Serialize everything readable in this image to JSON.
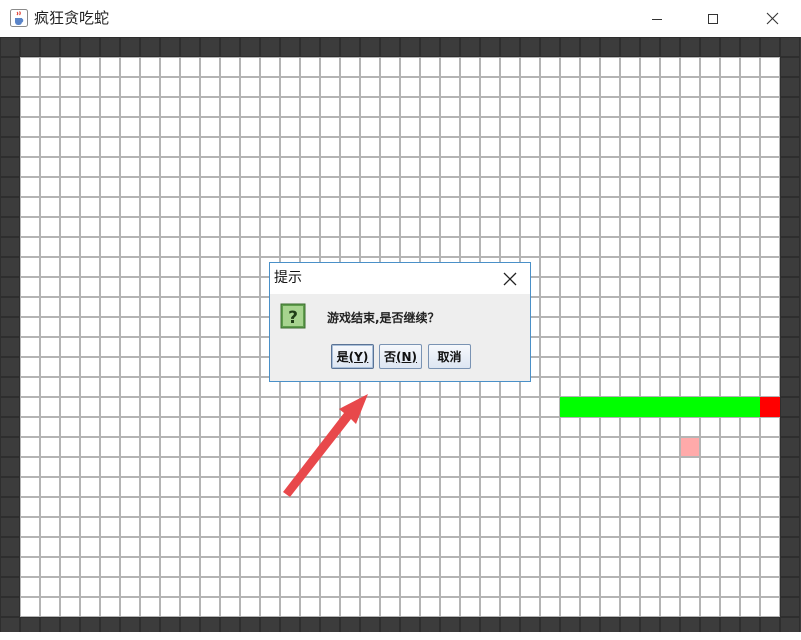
{
  "window": {
    "title": "疯狂贪吃蛇",
    "icon": "java-cup-icon"
  },
  "board": {
    "cols": 40,
    "rows": 30,
    "wall_color": "#3c3c3c",
    "cell_color": "#ffffff",
    "grid_line_color": "#b4b4b4",
    "snake": {
      "body_color": "#00ff00",
      "head_color": "#ff0000",
      "body": [
        [
          28,
          18
        ],
        [
          29,
          18
        ],
        [
          30,
          18
        ],
        [
          31,
          18
        ],
        [
          32,
          18
        ],
        [
          33,
          18
        ],
        [
          34,
          18
        ],
        [
          35,
          18
        ],
        [
          36,
          18
        ],
        [
          37,
          18
        ]
      ],
      "head": [
        38,
        18
      ]
    },
    "food": {
      "cell": [
        34,
        20
      ],
      "color": "#ffaaaa"
    }
  },
  "dialog": {
    "title": "提示",
    "message": "游戏结束,是否继续？",
    "icon": "question-icon",
    "buttons": {
      "yes": {
        "label": "是",
        "mnemonic": "(Y)"
      },
      "no": {
        "label": "否",
        "mnemonic": "(N)"
      },
      "cancel": {
        "label": "取消"
      }
    }
  },
  "annotation": {
    "arrow_color": "#e8484b"
  }
}
